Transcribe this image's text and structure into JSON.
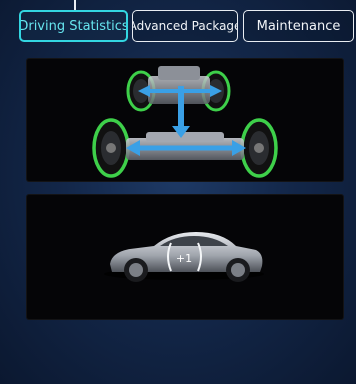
{
  "tabs": [
    {
      "label": "Driving Statistics",
      "active": true
    },
    {
      "label": "Advanced Package",
      "active": false
    },
    {
      "label": "Maintenance",
      "active": false
    }
  ],
  "eco_badge": {
    "text": "+1"
  },
  "colors": {
    "accent": "#33d6e1",
    "tire_glow": "#3ed04a",
    "arrow": "#3aa0e6",
    "background": "#132749"
  },
  "icons": [
    "awd-chassis-illustration",
    "sedan-car-illustration"
  ]
}
